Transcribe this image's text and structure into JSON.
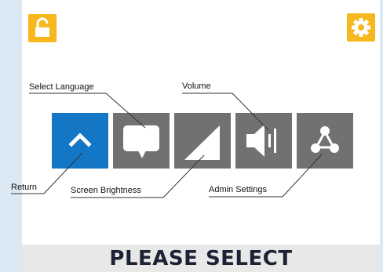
{
  "colors": {
    "accent_yellow": "#f6b81c",
    "tile_gray": "#717171",
    "tile_selected_blue": "#1377c6",
    "side_strip": "#dbe9f4",
    "footer_bg": "#e8e8e8",
    "footer_text": "#1b2233"
  },
  "top_bar": {
    "left_icon": "unlock-icon",
    "right_icon": "gear-icon"
  },
  "tiles": [
    {
      "id": "return",
      "icon": "chevron-up-icon",
      "selected": true
    },
    {
      "id": "select-language",
      "icon": "speech-bubble-icon",
      "selected": false
    },
    {
      "id": "screen-brightness",
      "icon": "brightness-ramp-icon",
      "selected": false
    },
    {
      "id": "volume",
      "icon": "speaker-icon",
      "selected": false
    },
    {
      "id": "admin-settings",
      "icon": "network-nodes-icon",
      "selected": false
    }
  ],
  "callouts": {
    "select_language": "Select Language",
    "volume": "Volume",
    "return": "Return",
    "screen_brightness": "Screen Brightness",
    "admin_settings": "Admin Settings"
  },
  "footer": {
    "prompt": "PLEASE SELECT"
  }
}
